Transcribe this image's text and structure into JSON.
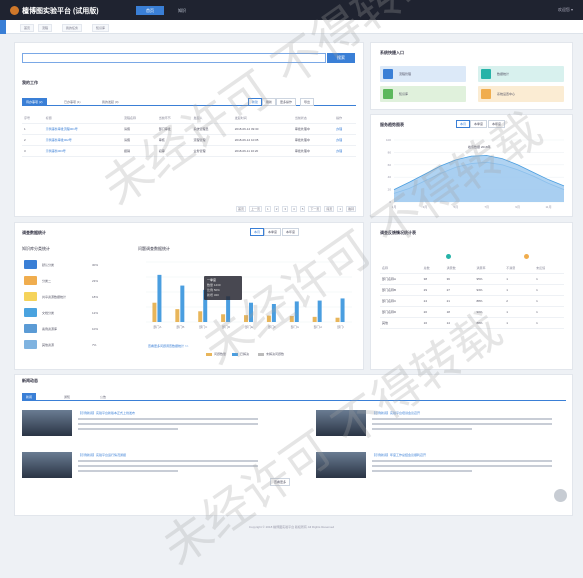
{
  "app": {
    "title": "檀博图实验平台 (试用版)",
    "nav": [
      "首页",
      "知识"
    ],
    "user": "欢迎您 ▾"
  },
  "breadcrumbs": [
    "首页",
    "流程",
    "我的任务",
    "知识库"
  ],
  "search": {
    "placeholder": "",
    "button": "搜索"
  },
  "todo": {
    "title": "我的工作",
    "tabs": [
      "待办事项 (2)",
      "已办事项 (1)",
      "我的发起 (0)"
    ],
    "actions": [
      "新建",
      "刷新",
      "更多操作",
      "导出"
    ],
    "columns": [
      "序号",
      "标题",
      "流程名称",
      "当前环节",
      "发起人",
      "发起时间",
      "当前状态",
      "操作"
    ],
    "rows": [
      [
        "1",
        "示例事务审批流程001号",
        "请假",
        "部门审批",
        "系统管理员",
        "2018-06-12 09:30",
        "审批处理中",
        "办理"
      ],
      [
        "2",
        "示例事务审批002号",
        "请假",
        "审核",
        "流程管理",
        "2018-06-12 10:05",
        "审批处理中",
        "办理"
      ],
      [
        "3",
        "示例事务003号",
        "报销",
        "初审",
        "业务管理",
        "2018-06-11 16:20",
        "审批处理中",
        "办理"
      ]
    ],
    "pager": [
      "首页",
      "上一页",
      "1",
      "2",
      "3",
      "4",
      "5",
      "下一页",
      "尾页",
      "1",
      "跳转"
    ]
  },
  "quick": {
    "title": "系统快捷入口",
    "items": [
      {
        "label": "流程管理",
        "color": "#3a7fd6",
        "bg": "#dce9f8"
      },
      {
        "label": "数据统计",
        "color": "#26b3a8",
        "bg": "#d8f1ee"
      },
      {
        "label": "知识库",
        "color": "#5cb85c",
        "bg": "#e0f1dc"
      },
      {
        "label": "系统设置中心",
        "color": "#f0ad4e",
        "bg": "#fbecd3"
      }
    ]
  },
  "trend": {
    "title": "服务趋势图表",
    "buttons": [
      "本月",
      "本季度",
      "本年度"
    ],
    "annotation": "峰值数据 2018年",
    "chart_data": {
      "type": "area",
      "x": [
        "1月",
        "2月",
        "3月",
        "4月",
        "5月",
        "6月",
        "7月",
        "8月",
        "9月",
        "10月",
        "11月",
        "12月"
      ],
      "series": [
        {
          "values": [
            20,
            32,
            45,
            58,
            68,
            74,
            75,
            70,
            60,
            48,
            36,
            26
          ]
        },
        {
          "values": [
            14,
            22,
            34,
            46,
            56,
            62,
            64,
            60,
            52,
            42,
            30,
            20
          ]
        }
      ],
      "ylim": [
        0,
        100
      ],
      "yticks": [
        "100",
        "80",
        "60",
        "40",
        "20",
        "0"
      ]
    }
  },
  "stats": {
    "title": "调查数据统计",
    "buttons": [
      "本月",
      "本季度",
      "本年度"
    ],
    "left_title": "知识库分类统计",
    "left_items": [
      {
        "label": "默认分类",
        "value": "30%",
        "color": "#3a7fd6"
      },
      {
        "label": "分类二",
        "value": "23%",
        "color": "#f0ad4e"
      },
      {
        "label": "共享资源数据统计",
        "value": "18%",
        "color": "#f5d35a"
      },
      {
        "label": "文档分类",
        "value": "12%",
        "color": "#4aa3df"
      },
      {
        "label": "案例资源库",
        "value": "10%",
        "color": "#5b9bd5"
      },
      {
        "label": "其他资源",
        "value": "7%",
        "color": "#7fb3e0"
      }
    ],
    "bar_title": "问题调查数据统计",
    "tooltip": [
      "一季度",
      "数量 1230",
      "比例 50%",
      "新增 320"
    ],
    "bar_note": "查看更多问题调查数据统计 >>",
    "chart_data": {
      "type": "bar",
      "categories": [
        "部门A",
        "部门B",
        "部门C",
        "部门D",
        "部门E",
        "部门F",
        "部门G",
        "部门H",
        "部门I"
      ],
      "series": [
        {
          "name": "问题数量",
          "values": [
            45,
            30,
            25,
            18,
            16,
            15,
            14,
            12,
            10
          ],
          "color": "#e8b55a"
        },
        {
          "name": "已解决",
          "values": [
            110,
            85,
            75,
            60,
            45,
            42,
            48,
            50,
            55
          ],
          "color": "#4a9ee0"
        }
      ],
      "ylim": [
        0,
        140
      ],
      "legend": [
        "问题数量",
        "已解决",
        "未解决问题数"
      ]
    }
  },
  "ranking": {
    "title": "调查反馈情况统计表",
    "columns": [
      "名称",
      "总数",
      "满意数",
      "满意率",
      "不满意",
      "未反馈"
    ],
    "markers": [
      "#26b3a8",
      "#f0ad4e"
    ],
    "rows": [
      [
        "部门名称A",
        "38",
        "36",
        "95%",
        "1",
        "1"
      ],
      [
        "部门名称B",
        "29",
        "27",
        "93%",
        "1",
        "1"
      ],
      [
        "部门名称C",
        "24",
        "21",
        "88%",
        "2",
        "1"
      ],
      [
        "部门名称D",
        "20",
        "18",
        "90%",
        "1",
        "1"
      ],
      [
        "其他",
        "16",
        "14",
        "88%",
        "1",
        "1"
      ]
    ]
  },
  "news": {
    "title": "新闻动态",
    "tabs": [
      "新闻",
      "通知",
      "公告"
    ],
    "items": [
      {
        "title": "【示例新闻】实验平台新版本正式上线发布"
      },
      {
        "title": "【示例新闻】实验平台培训会议召开"
      },
      {
        "title": "【示例新闻】实验平台运行情况通报"
      },
      {
        "title": "【示例新闻】年度工作总结会议顺利召开"
      }
    ],
    "more": "查看更多"
  },
  "footer": "Copyright © 2018 檀博图实验平台 版权所有 All Rights Reserved",
  "watermark": [
    "未经许可 不得转载",
    "未经许可 不得转载",
    "未经许可 不得转载"
  ]
}
